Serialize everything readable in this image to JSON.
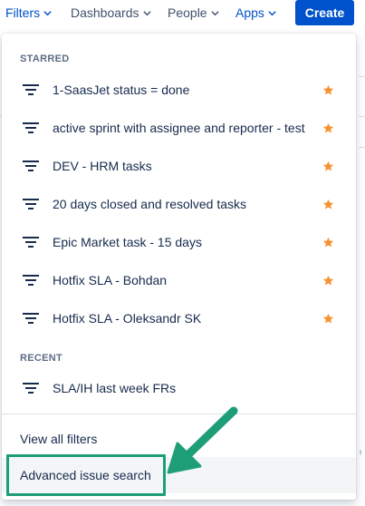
{
  "nav": {
    "filters": "Filters",
    "dashboards": "Dashboards",
    "people": "People",
    "apps": "Apps",
    "create": "Create"
  },
  "dropdown": {
    "starred_title": "STARRED",
    "starred": [
      {
        "label": "1-SaasJet status = done",
        "icon": "filter-icon",
        "starred": true
      },
      {
        "label": "active sprint with assignee and reporter - test",
        "icon": "filter-icon",
        "starred": true
      },
      {
        "label": "DEV - HRM tasks",
        "icon": "filter-icon",
        "starred": true
      },
      {
        "label": "20 days closed and resolved tasks",
        "icon": "filter-icon",
        "starred": true
      },
      {
        "label": "Epic Market task - 15 days",
        "icon": "filter-icon",
        "starred": true
      },
      {
        "label": "Hotfix SLA - Bohdan",
        "icon": "filter-icon",
        "starred": true
      },
      {
        "label": "Hotfix SLA - Oleksandr SK",
        "icon": "filter-icon",
        "starred": true
      }
    ],
    "recent_title": "RECENT",
    "recent": [
      {
        "label": "SLA/IH last week FRs",
        "icon": "filter-icon"
      }
    ],
    "view_all": "View all filters",
    "advanced_search": "Advanced issue search"
  },
  "colors": {
    "brand": "#0052cc",
    "star": "#f79232",
    "annotation": "#1e9e77"
  }
}
